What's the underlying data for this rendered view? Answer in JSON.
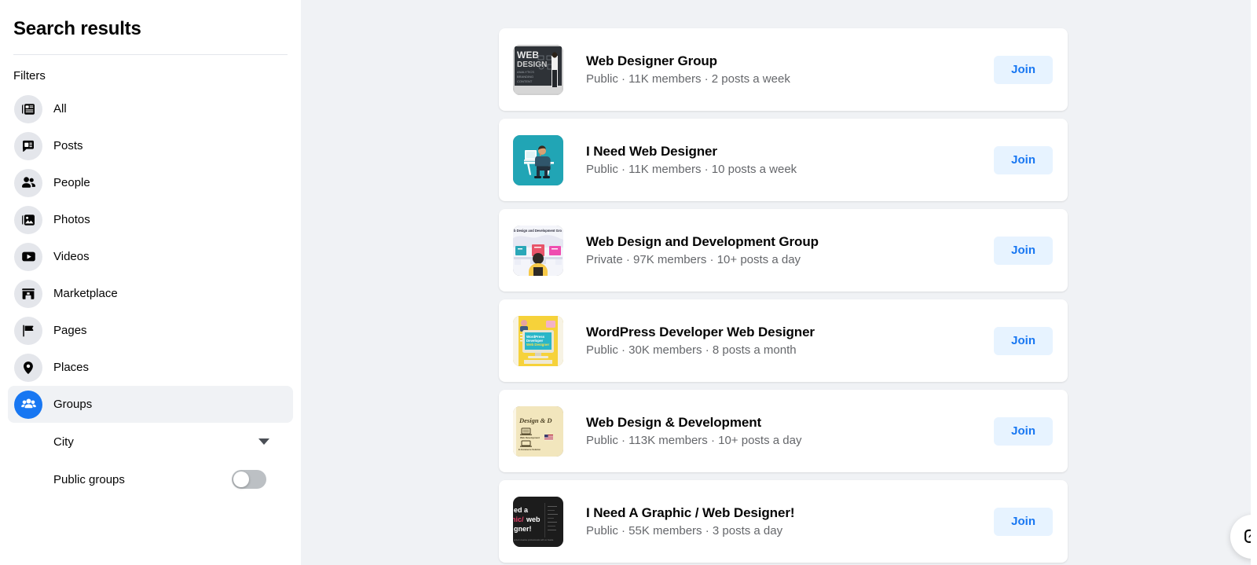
{
  "sidebar": {
    "title": "Search results",
    "filters_label": "Filters",
    "items": [
      {
        "label": "All",
        "icon": "cards-icon",
        "active": false
      },
      {
        "label": "Posts",
        "icon": "comment-icon",
        "active": false
      },
      {
        "label": "People",
        "icon": "people-icon",
        "active": false
      },
      {
        "label": "Photos",
        "icon": "photo-icon",
        "active": false
      },
      {
        "label": "Videos",
        "icon": "video-icon",
        "active": false
      },
      {
        "label": "Marketplace",
        "icon": "storefront-icon",
        "active": false
      },
      {
        "label": "Pages",
        "icon": "flag-icon",
        "active": false
      },
      {
        "label": "Places",
        "icon": "location-pin-icon",
        "active": false
      },
      {
        "label": "Groups",
        "icon": "groups-icon",
        "active": true
      }
    ],
    "city_filter": {
      "label": "City",
      "icon": "chevron-down-icon"
    },
    "public_groups_filter": {
      "label": "Public groups",
      "enabled": false
    }
  },
  "main": {
    "join_label": "Join",
    "chat_fab_icon": "messenger-icon",
    "results": [
      {
        "title": "Web Designer Group",
        "meta": "Public · 11K members · 2 posts a week",
        "privacy": "Public",
        "members": "11K members",
        "activity": "2 posts a week",
        "thumbnail": "chalkboard-web-design-photo",
        "thumbnail_colors": [
          "#2b2f33",
          "#d9d9d9"
        ],
        "join_label": "Join"
      },
      {
        "title": "I Need Web Designer",
        "meta": "Public · 11K members · 10 posts a week",
        "privacy": "Public",
        "members": "11K members",
        "activity": "10 posts a week",
        "thumbnail": "teal-desk-illustration",
        "thumbnail_colors": [
          "#21a5b5",
          "#ffffff"
        ],
        "join_label": "Join"
      },
      {
        "title": "Web Design and Development Group",
        "meta": "Private · 97K members · 10+ posts a day",
        "privacy": "Private",
        "members": "97K members",
        "activity": "10+ posts a day",
        "thumbnail": "monitors-workstation-illustration",
        "thumbnail_colors": [
          "#eceef5",
          "#f7c948",
          "#2aa7b8",
          "#e8546a",
          "#ef4db0"
        ],
        "join_label": "Join"
      },
      {
        "title": "WordPress Developer Web Designer",
        "meta": "Public · 30K members · 8 posts a month",
        "privacy": "Public",
        "members": "30K members",
        "activity": "8 posts a month",
        "thumbnail": "yellow-monitor-illustration",
        "thumbnail_colors": [
          "#f6d23a",
          "#2ab6c8"
        ],
        "join_label": "Join"
      },
      {
        "title": "Web Design & Development",
        "meta": "Public · 113K members · 10+ posts a day",
        "privacy": "Public",
        "members": "113K members",
        "activity": "10+ posts a day",
        "thumbnail": "cream-design-and-development-card",
        "thumbnail_colors": [
          "#f2e6bd",
          "#4a3f22"
        ],
        "join_label": "Join"
      },
      {
        "title": "I Need A Graphic / Web Designer!",
        "meta": "Public · 55K members · 3 posts a day",
        "privacy": "Public",
        "members": "55K members",
        "activity": "3 posts a day",
        "thumbnail": "dark-need-a-graphic-web-designer-poster",
        "thumbnail_colors": [
          "#1c1c1c",
          "#ffffff",
          "#e8406a"
        ],
        "join_label": "Join"
      }
    ]
  },
  "colors": {
    "page_bg": "#f0f2f5",
    "card_bg": "#ffffff",
    "accent_blue": "#1877f2",
    "join_bg": "#e7f3ff",
    "text_primary": "#050505",
    "text_secondary": "#65676b",
    "icon_bg": "#e4e6eb"
  }
}
